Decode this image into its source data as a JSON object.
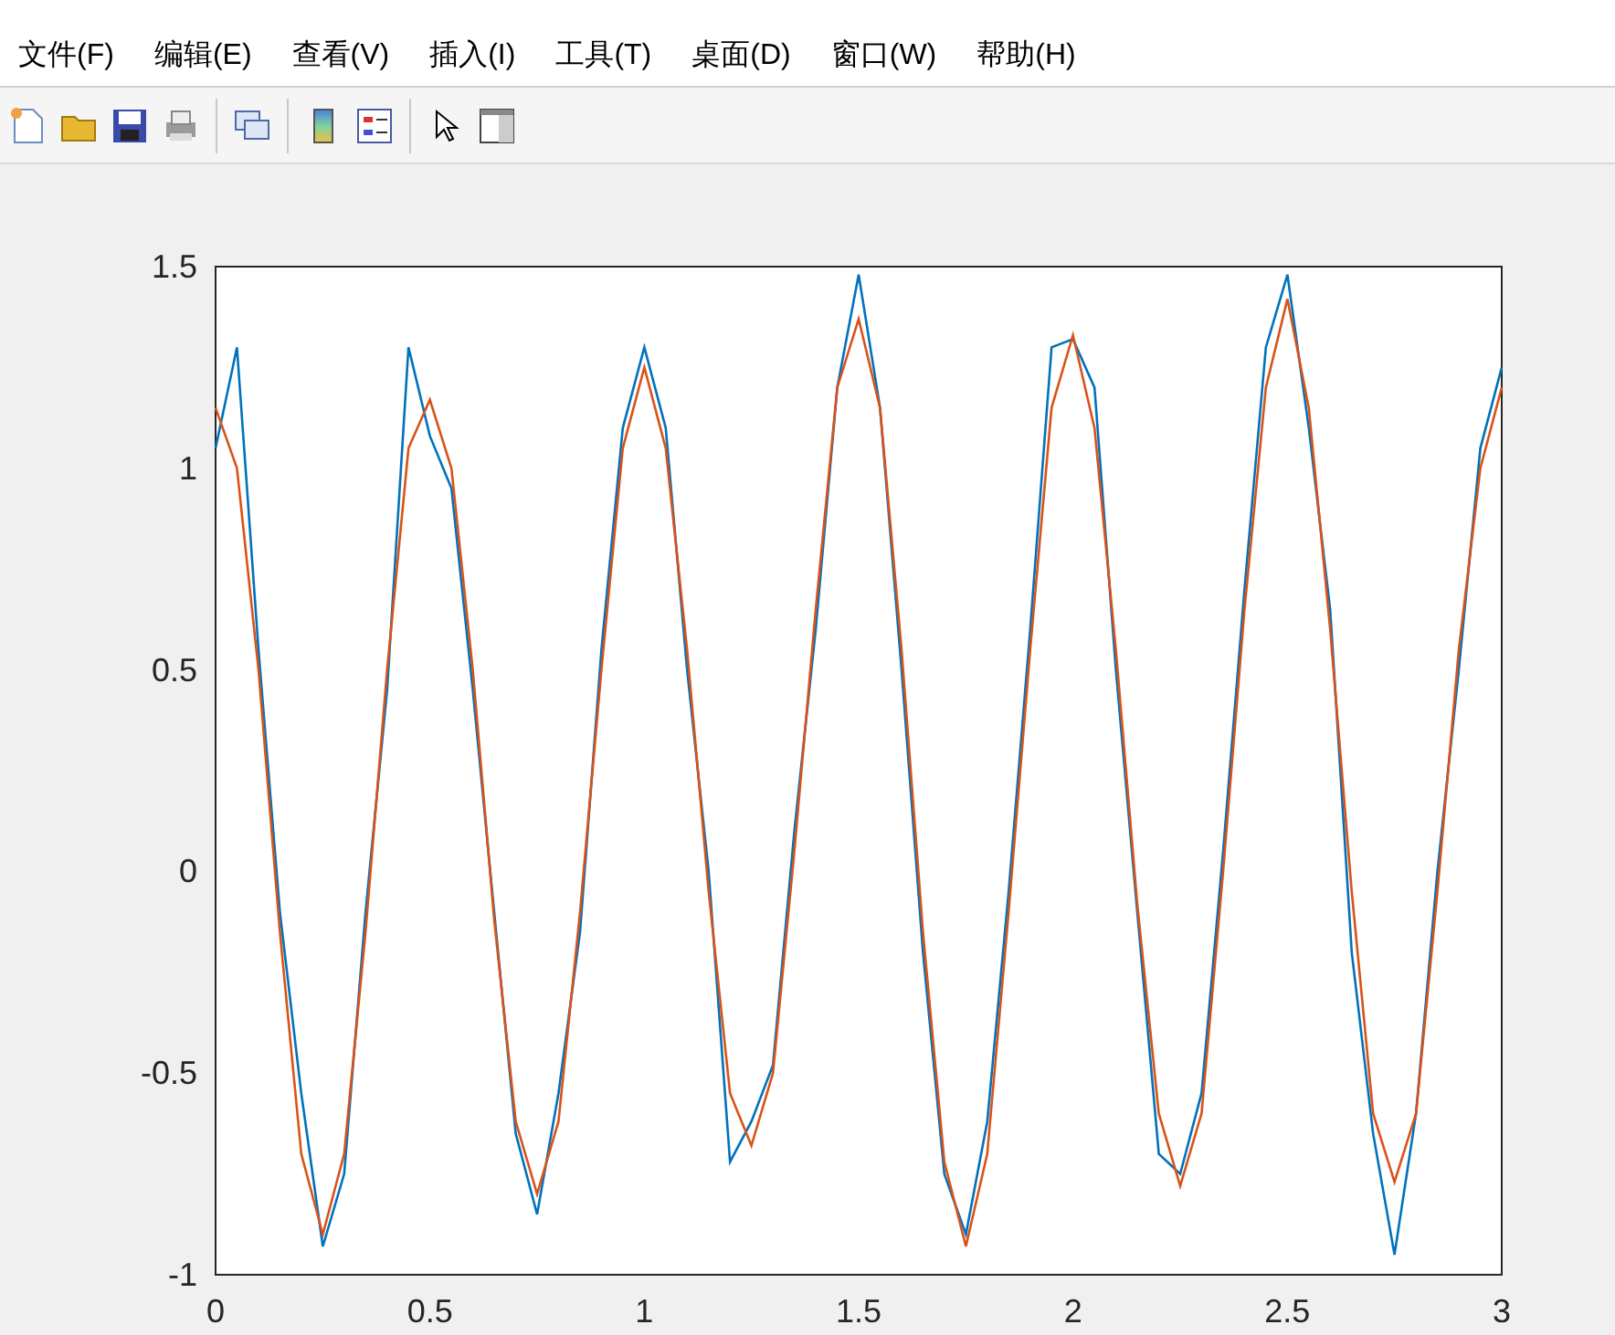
{
  "menu": [
    {
      "label": "文件(F)"
    },
    {
      "label": "编辑(E)"
    },
    {
      "label": "查看(V)"
    },
    {
      "label": "插入(I)"
    },
    {
      "label": "工具(T)"
    },
    {
      "label": "桌面(D)"
    },
    {
      "label": "窗口(W)"
    },
    {
      "label": "帮助(H)"
    }
  ],
  "plot": {
    "chart_data": {
      "type": "line",
      "x": [
        0,
        0.05,
        0.1,
        0.15,
        0.2,
        0.25,
        0.3,
        0.35,
        0.4,
        0.45,
        0.5,
        0.55,
        0.6,
        0.65,
        0.7,
        0.75,
        0.8,
        0.85,
        0.9,
        0.95,
        1,
        1.05,
        1.1,
        1.15,
        1.2,
        1.25,
        1.3,
        1.35,
        1.4,
        1.45,
        1.5,
        1.55,
        1.6,
        1.65,
        1.7,
        1.75,
        1.8,
        1.85,
        1.9,
        1.95,
        2,
        2.05,
        2.1,
        2.15,
        2.2,
        2.25,
        2.3,
        2.35,
        2.4,
        2.45,
        2.5,
        2.55,
        2.6,
        2.65,
        2.7,
        2.75,
        2.8,
        2.85,
        2.9,
        2.95,
        3
      ],
      "series": [
        {
          "color": "#0072bd",
          "values": [
            1.05,
            1.3,
            0.55,
            -0.1,
            -0.55,
            -0.93,
            -0.75,
            -0.1,
            0.45,
            1.3,
            1.08,
            0.95,
            0.45,
            -0.1,
            -0.65,
            -0.85,
            -0.55,
            -0.15,
            0.55,
            1.1,
            1.3,
            1.1,
            0.5,
            0.0,
            -0.72,
            -0.62,
            -0.48,
            0.1,
            0.6,
            1.2,
            1.48,
            1.15,
            0.5,
            -0.2,
            -0.75,
            -0.9,
            -0.62,
            -0.05,
            0.6,
            1.3,
            1.32,
            1.2,
            0.5,
            -0.1,
            -0.7,
            -0.75,
            -0.55,
            0.05,
            0.7,
            1.3,
            1.48,
            1.1,
            0.65,
            -0.2,
            -0.65,
            -0.95,
            -0.6,
            0.0,
            0.5,
            1.05,
            1.25
          ]
        },
        {
          "color": "#d95319",
          "values": [
            1.15,
            1.0,
            0.5,
            -0.15,
            -0.7,
            -0.9,
            -0.7,
            -0.15,
            0.5,
            1.05,
            1.17,
            1.0,
            0.5,
            -0.12,
            -0.62,
            -0.8,
            -0.62,
            -0.1,
            0.5,
            1.05,
            1.25,
            1.05,
            0.55,
            -0.05,
            -0.55,
            -0.68,
            -0.5,
            0.05,
            0.65,
            1.2,
            1.37,
            1.15,
            0.55,
            -0.15,
            -0.72,
            -0.93,
            -0.7,
            -0.1,
            0.55,
            1.15,
            1.33,
            1.1,
            0.55,
            -0.08,
            -0.6,
            -0.78,
            -0.6,
            0.0,
            0.65,
            1.2,
            1.42,
            1.15,
            0.6,
            -0.05,
            -0.6,
            -0.77,
            -0.6,
            -0.05,
            0.55,
            1.0,
            1.2
          ]
        }
      ],
      "xlim": [
        0,
        3
      ],
      "ylim": [
        -1,
        1.5
      ],
      "xticks": [
        0,
        {
          "value": 0.5,
          "label": "0.5"
        },
        1,
        {
          "value": 1.5,
          "label": "1.5"
        },
        2,
        {
          "value": 2.5,
          "label": "2.5"
        },
        3
      ],
      "yticks": [
        {
          "value": -1,
          "label": "-1"
        },
        {
          "value": -0.5,
          "label": "-0.5"
        },
        0,
        {
          "value": 0.5,
          "label": "0.5"
        },
        1,
        {
          "value": 1.5,
          "label": "1.5"
        }
      ]
    }
  }
}
